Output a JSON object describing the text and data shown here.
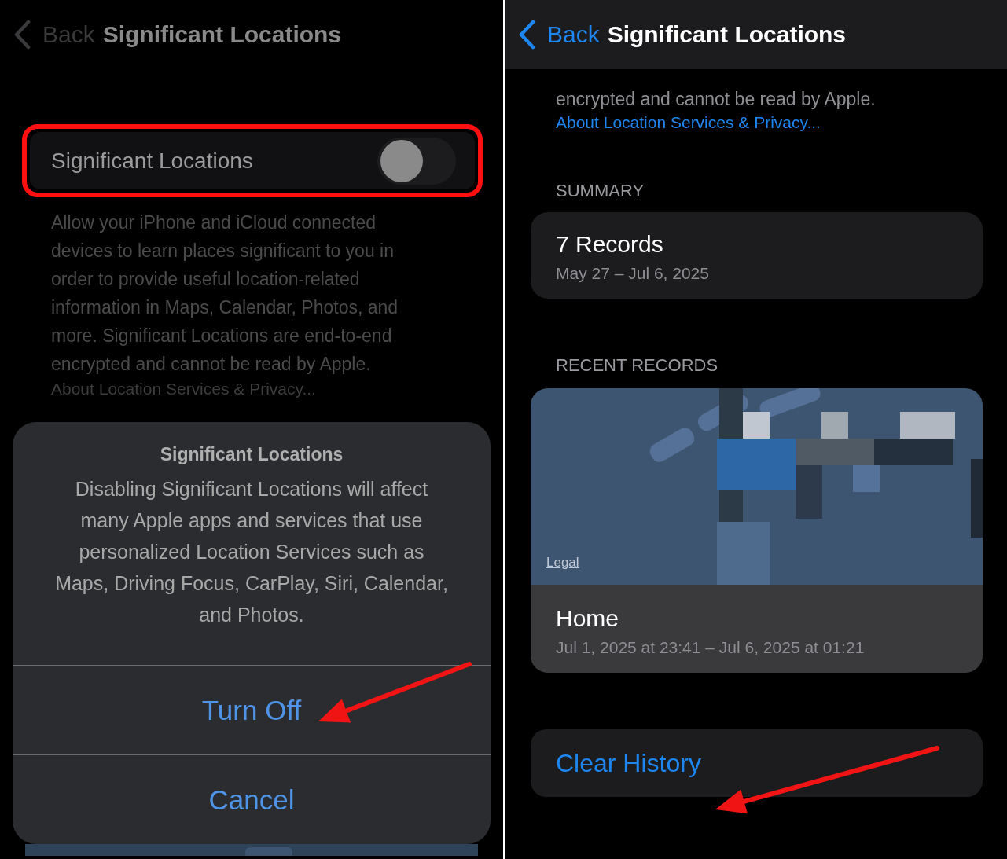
{
  "left_screen": {
    "nav": {
      "back": "Back",
      "title": "Significant Locations"
    },
    "toggle_row": {
      "label": "Significant Locations",
      "on": false,
      "highlighted": true
    },
    "description": "Allow your iPhone and iCloud connected devices to learn places significant to you in order to provide useful location-related information in Maps, Calendar, Photos, and more. Significant Locations are end-to-end encrypted and cannot be read by Apple.",
    "link": "About Location Services & Privacy...",
    "alert": {
      "title": "Significant Locations",
      "message": "Disabling Significant Locations will affect many Apple apps and services that use personalized Location Services such as Maps, Driving Focus, CarPlay, Siri, Calendar, and Photos.",
      "actions": [
        {
          "label": "Turn Off",
          "annotated": true
        },
        {
          "label": "Cancel",
          "annotated": false
        }
      ]
    }
  },
  "right_screen": {
    "nav": {
      "back": "Back",
      "title": "Significant Locations"
    },
    "description_tail": "encrypted and cannot be read by Apple.",
    "link": "About Location Services & Privacy...",
    "summary": {
      "header": "SUMMARY",
      "title": "7 Records",
      "dates": "May 27 – Jul 6, 2025"
    },
    "recent": {
      "header": "RECENT RECORDS",
      "map_link": "Legal",
      "place": "Home",
      "time": "Jul 1, 2025 at 23:41 – Jul 6, 2025 at 01:21"
    },
    "clear_button": {
      "label": "Clear History",
      "annotated": true
    }
  }
}
